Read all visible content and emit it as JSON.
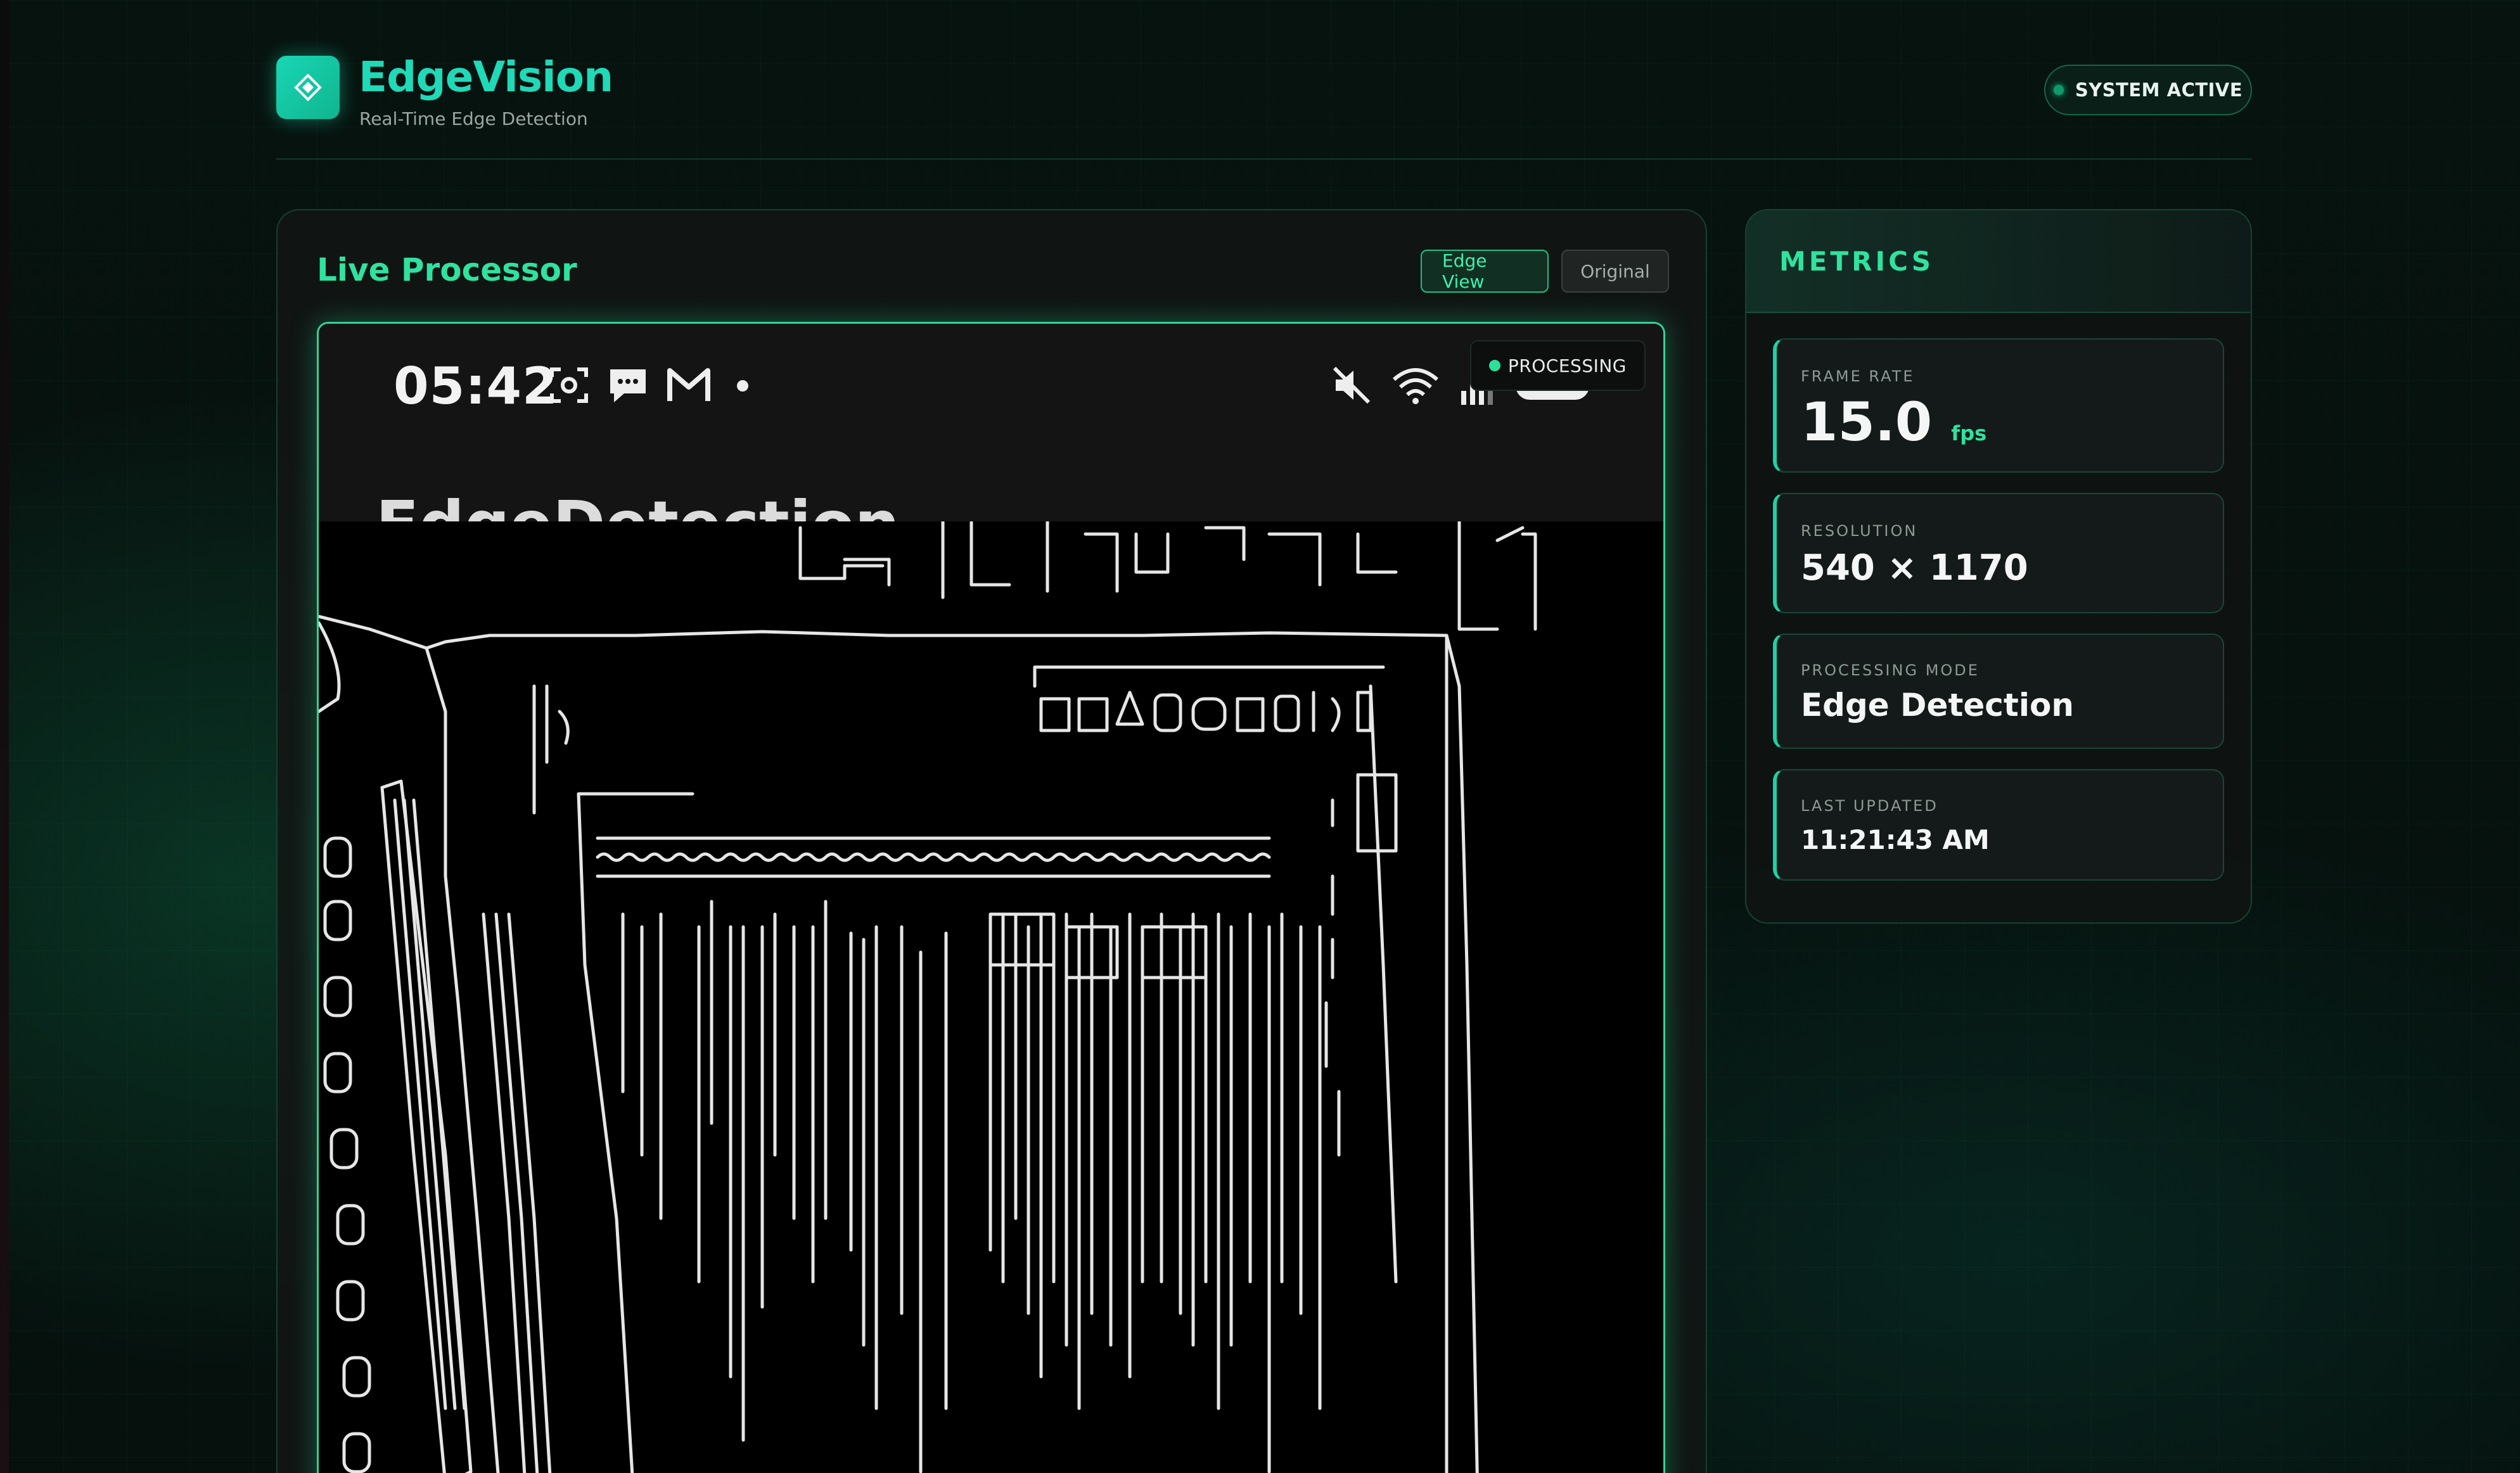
{
  "header": {
    "title": "EdgeVision",
    "subtitle": "Real-Time Edge Detection",
    "status": "SYSTEM ACTIVE"
  },
  "processor": {
    "title": "Live Processor",
    "toggle_edge": "Edge View",
    "toggle_original": "Original",
    "badge": "PROCESSING",
    "phone_time": "05:42",
    "app_title": "EdgeDetection"
  },
  "metrics": {
    "title": "METRICS",
    "frame_rate": {
      "label": "FRAME RATE",
      "value": "15.0",
      "unit": "fps"
    },
    "resolution": {
      "label": "RESOLUTION",
      "value": "540 × 1170"
    },
    "mode": {
      "label": "PROCESSING MODE",
      "value": "Edge Detection"
    },
    "updated": {
      "label": "LAST UPDATED",
      "value": "11:21:43 AM"
    }
  },
  "colors": {
    "accent": "#2fe2a0",
    "brand": "#1fd9b7",
    "background": "#07130f"
  },
  "icons": [
    "diamond-logo-icon",
    "screenshot-icon",
    "chat-icon",
    "gmail-icon",
    "dot-icon",
    "mute-icon",
    "wifi-icon",
    "signal-icon",
    "battery-icon"
  ]
}
